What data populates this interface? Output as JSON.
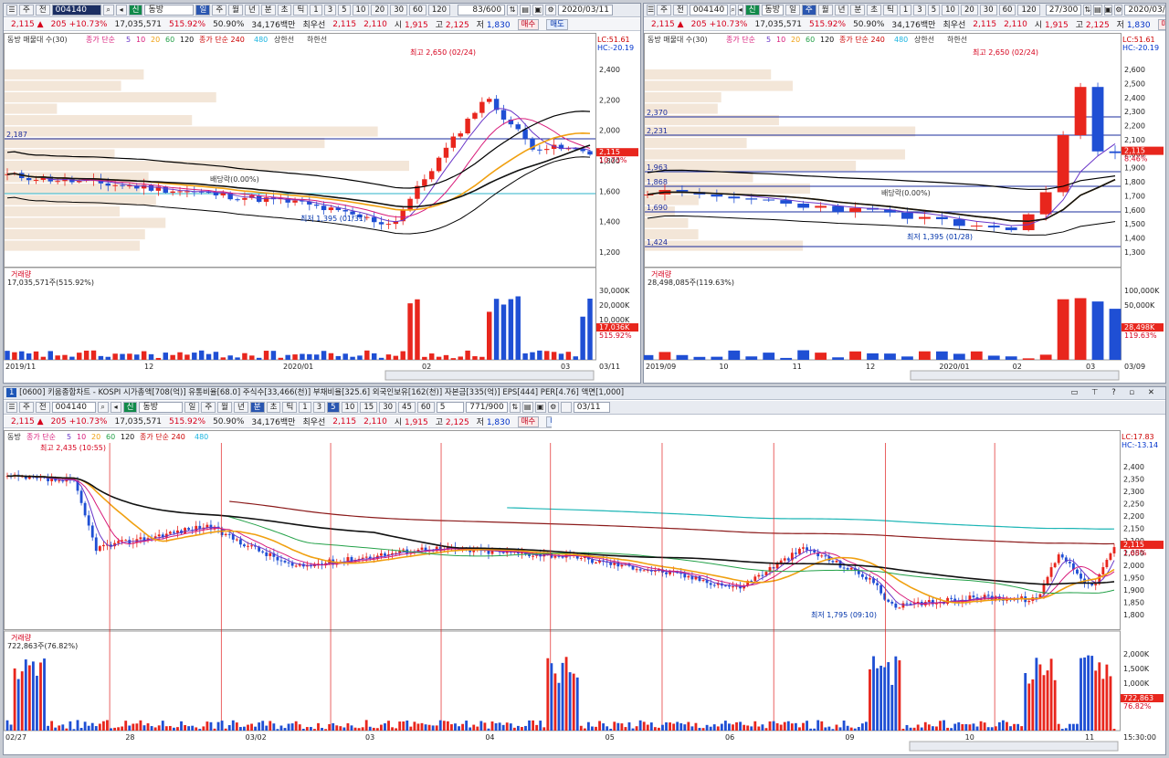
{
  "stock": {
    "code": "004140",
    "name": "동방",
    "market_icon": "신",
    "price": "2,115",
    "arrow": "▲",
    "change": "205",
    "change_pct": "+10.73%",
    "volume": "17,035,571",
    "vol_ratio": "515.92%",
    "vol_ratio2": "50.90%",
    "amount": "34,176백만",
    "pref_label": "최우선",
    "ask": "2,115",
    "bid": "2,110",
    "open_lbl": "시",
    "open": "1,915",
    "high_lbl": "고",
    "high": "2,125",
    "low_lbl": "저",
    "low": "1,830",
    "buy": "매수",
    "sell": "매도"
  },
  "toolbar": {
    "main_label": "주",
    "jeon": "전",
    "periods": [
      "일",
      "주",
      "월",
      "년",
      "분",
      "초",
      "틱"
    ],
    "minutes": [
      "1",
      "3",
      "5",
      "10",
      "20",
      "30",
      "60",
      "120"
    ],
    "bottom_minutes": [
      "1",
      "3",
      "5",
      "10",
      "15",
      "30",
      "45",
      "60"
    ]
  },
  "panel_left": {
    "count": "83/600",
    "date": "2020/03/11",
    "legend": {
      "a": "동방 매물대 수(30)",
      "b": "종가 단순",
      "c": "종가 단순 240",
      "d": "480",
      "e": "상한선",
      "f": "하한선"
    },
    "ma_nums": [
      "5",
      "10",
      "20",
      "60",
      "120"
    ],
    "lc": "LC:51.61",
    "hc": "HC:-20.19",
    "yaxis": [
      "2,400",
      "2,200",
      "2,000",
      "1,800",
      "1,600",
      "1,400",
      "1,200"
    ],
    "price_tag": "2,115",
    "price_pct": "10.73%",
    "level": "2,187",
    "high_note": "최고 2,650 (02/24)",
    "low_note": "최저 1,395 (01/31)",
    "div_note": "배당락(0.00%)",
    "vol_title": "거래량",
    "vol_value": "17,035,571주(515.92%)",
    "vol_axis": [
      "30,000K",
      "20,000K",
      "10,000K"
    ],
    "vol_tag": "17,036K",
    "vol_tag_pct": "515.92%",
    "xaxis": [
      "2019/11",
      "12",
      "2020/01",
      "02",
      "03"
    ],
    "xend": "03/11"
  },
  "panel_right": {
    "count": "27/300",
    "date": "2020/03/0",
    "legend": {
      "a": "동방 매물대 수(30)",
      "b": "종가 단순",
      "c": "종가 단순 240",
      "d": "480",
      "e": "상한선",
      "f": "하한선"
    },
    "ma_nums": [
      "5",
      "10",
      "20",
      "60",
      "120"
    ],
    "lc": "LC:51.61",
    "hc": "HC:-20.19",
    "yaxis": [
      "2,600",
      "2,500",
      "2,400",
      "2,300",
      "2,200",
      "2,100",
      "2,000",
      "1,900",
      "1,800",
      "1,700",
      "1,600",
      "1,500",
      "1,400",
      "1,300"
    ],
    "price_tag": "2,115",
    "price_pct": "8.46%",
    "levels": [
      "2,370",
      "2,231",
      "1,963",
      "1,868",
      "1,690",
      "1,424"
    ],
    "high_note": "최고 2,650 (02/24)",
    "low_note": "최저 1,395 (01/28)",
    "div_note": "배당락(0.00%)",
    "vol_title": "거래량",
    "vol_value": "28,498,085주(119.63%)",
    "vol_axis": [
      "100,000K",
      "50,000K"
    ],
    "vol_tag": "28,498K",
    "vol_tag_pct": "119.63%",
    "xaxis": [
      "2019/09",
      "10",
      "11",
      "12",
      "2020/01",
      "02",
      "03"
    ],
    "xend": "03/09"
  },
  "panel_bottom": {
    "title_num": "1",
    "title": "[0600] 키움종합차트 - KOSPI 시가총액[708(억)] 유통비율[68.0] 주식수[33,466(천)] 부채비율[325.6] 외국인보유[162(천)] 자본금[335(억)] EPS[444] PER[4.76] 액면[1,000]",
    "count": "771/900",
    "date": "03/11",
    "minute_sel": "5",
    "legend": {
      "a": "동방",
      "b": "종가 단순",
      "c": "종가 단순 240",
      "d": "480"
    },
    "ma_nums": [
      "5",
      "10",
      "20",
      "60",
      "120"
    ],
    "lc": "LC:17.83",
    "hc": "HC:-13.14",
    "yaxis": [
      "2,400",
      "2,350",
      "2,300",
      "2,250",
      "2,200",
      "2,150",
      "2,100",
      "2,050",
      "2,000",
      "1,950",
      "1,900",
      "1,850",
      "1,800"
    ],
    "price_tag": "2,115",
    "price_pct": "1.68%",
    "high_note": "최고 2,435 (10:55)",
    "low_note": "최저 1,795 (09:10)",
    "vol_title": "거래량",
    "vol_value": "722,863주(76.82%)",
    "vol_axis": [
      "2,000K",
      "1,500K",
      "1,000K",
      "500K"
    ],
    "vol_tag": "722,863",
    "vol_tag_pct": "76.82%",
    "xaxis": [
      "02/27",
      "28",
      "03/02",
      "03",
      "04",
      "05",
      "06",
      "09",
      "10",
      "11"
    ],
    "xend": "15:30:00"
  },
  "colors": {
    "up": "#e8261d",
    "down": "#1f4fd4",
    "ma5": "#6a36c8",
    "ma10": "#d81b7a",
    "ma20": "#f0a010",
    "ma60": "#23a148",
    "ma120": "#111111"
  }
}
